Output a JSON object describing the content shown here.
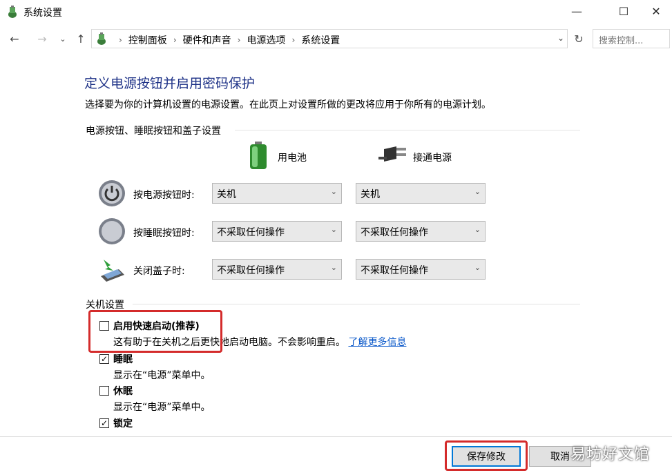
{
  "window": {
    "title": "系统设置",
    "minimize": "—",
    "maximize": "☐",
    "close": "✕"
  },
  "address": {
    "crumbs": [
      "控制面板",
      "硬件和声音",
      "电源选项",
      "系统设置"
    ],
    "search_placeholder": "搜索控制..."
  },
  "page": {
    "heading": "定义电源按钮并启用密码保护",
    "description": "选择要为你的计算机设置的电源设置。在此页上对设置所做的更改将应用于你所有的电源计划。"
  },
  "buttons_section": {
    "title": "电源按钮、睡眠按钮和盖子设置",
    "battery_label": "用电池",
    "plugged_label": "接通电源",
    "rows": [
      {
        "label": "按电源按钮时:",
        "battery": "关机",
        "plugged": "关机"
      },
      {
        "label": "按睡眠按钮时:",
        "battery": "不采取任何操作",
        "plugged": "不采取任何操作"
      },
      {
        "label": "关闭盖子时:",
        "battery": "不采取任何操作",
        "plugged": "不采取任何操作"
      }
    ]
  },
  "shutdown_section": {
    "title": "关机设置",
    "items": [
      {
        "label": "启用快速启动(推荐)",
        "checked": false,
        "desc": "这有助于在关机之后更快地启动电脑。不会影响重启。",
        "link": "了解更多信息"
      },
      {
        "label": "睡眠",
        "checked": true,
        "desc": "显示在“电源”菜单中。"
      },
      {
        "label": "休眠",
        "checked": false,
        "desc": "显示在“电源”菜单中。"
      },
      {
        "label": "锁定",
        "checked": true
      }
    ]
  },
  "footer": {
    "save": "保存修改",
    "cancel": "取消"
  },
  "watermark": "易坊好文馆",
  "colors": {
    "heading": "#1e3287",
    "highlight": "#d42b2b",
    "link": "#0a58ca"
  }
}
